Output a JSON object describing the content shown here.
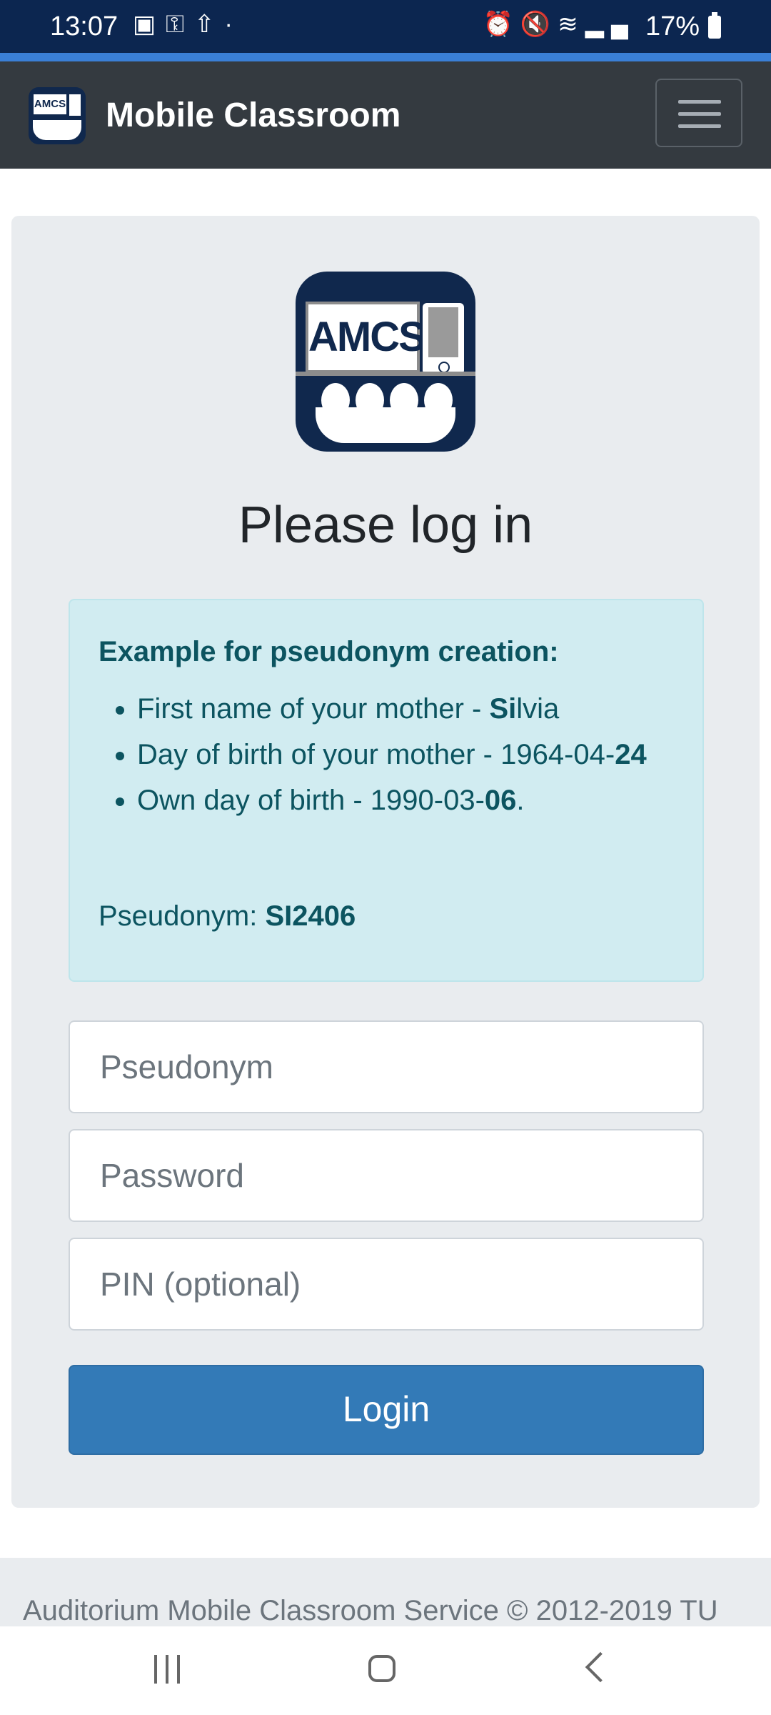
{
  "status_bar": {
    "time": "13:07",
    "battery": "17%",
    "left_icons": [
      "image-icon",
      "key-icon",
      "upload-icon",
      "dot-icon"
    ],
    "right_icons": [
      "alarm-icon",
      "mute-icon",
      "wifi-icon",
      "signal-icon",
      "battery-icon"
    ]
  },
  "navbar": {
    "logo_text": "AMCS",
    "title": "Mobile Classroom"
  },
  "login": {
    "logo_text": "AMCS",
    "heading": "Please log in",
    "info": {
      "title": "Example for pseudonym creation:",
      "items": [
        {
          "prefix": "First name of your mother - ",
          "bold": "Si",
          "suffix": "lvia"
        },
        {
          "prefix": "Day of birth of your mother - 1964-04-",
          "bold": "24",
          "suffix": ""
        },
        {
          "prefix": "Own day of birth - 1990-03-",
          "bold": "06",
          "suffix": "."
        }
      ],
      "pseudonym_label": "Pseudonym: ",
      "pseudonym_value": "SI2406"
    },
    "fields": {
      "pseudonym_placeholder": "Pseudonym",
      "password_placeholder": "Password",
      "pin_placeholder": "PIN (optional)"
    },
    "button_label": "Login"
  },
  "footer": {
    "text": "Auditorium Mobile Classroom Service © 2012-2019 TU"
  },
  "colors": {
    "status_bar": "#0c2650",
    "accent": "#3a7fd6",
    "navbar": "#343a40",
    "info_bg": "#d1ecf1",
    "info_text": "#0c5460",
    "primary_button": "#337ab7"
  }
}
